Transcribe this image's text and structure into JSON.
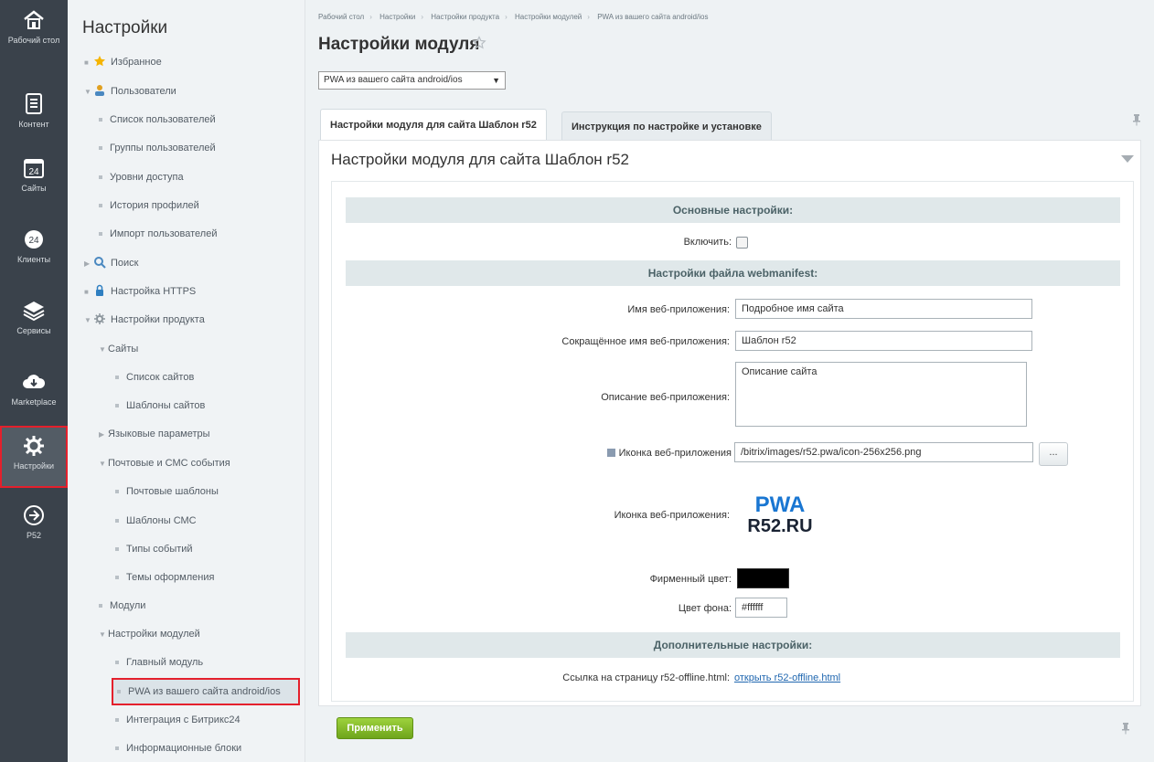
{
  "rail": [
    {
      "label": "Рабочий стол",
      "icon": "home-icon"
    },
    {
      "label": "Контент",
      "icon": "document-icon"
    },
    {
      "label": "Сайты",
      "icon": "calendar-icon",
      "badge": "24"
    },
    {
      "label": "Клиенты",
      "icon": "bitrix24-icon",
      "badge": "24"
    },
    {
      "label": "Сервисы",
      "icon": "layers-icon"
    },
    {
      "label": "Marketplace",
      "icon": "cloud-download-icon"
    },
    {
      "label": "Настройки",
      "icon": "gear-icon"
    },
    {
      "label": "Р52",
      "icon": "arrow-circle-icon"
    }
  ],
  "menu": {
    "title": "Настройки",
    "items": [
      {
        "label": "Избранное"
      },
      {
        "label": "Пользователи"
      },
      {
        "label": "Список пользователей"
      },
      {
        "label": "Группы пользователей"
      },
      {
        "label": "Уровни доступа"
      },
      {
        "label": "История профилей"
      },
      {
        "label": "Импорт пользователей"
      },
      {
        "label": "Поиск"
      },
      {
        "label": "Настройка HTTPS"
      },
      {
        "label": "Настройки продукта"
      },
      {
        "label": "Сайты"
      },
      {
        "label": "Список сайтов"
      },
      {
        "label": "Шаблоны сайтов"
      },
      {
        "label": "Языковые параметры"
      },
      {
        "label": "Почтовые и СМС события"
      },
      {
        "label": "Почтовые шаблоны"
      },
      {
        "label": "Шаблоны СМС"
      },
      {
        "label": "Типы событий"
      },
      {
        "label": "Темы оформления"
      },
      {
        "label": "Модули"
      },
      {
        "label": "Настройки модулей"
      },
      {
        "label": "Главный модуль"
      },
      {
        "label": "PWA из вашего сайта android/ios"
      },
      {
        "label": "Интеграция с Битрикс24"
      },
      {
        "label": "Информационные блоки"
      }
    ]
  },
  "breadcrumb": [
    "Рабочий стол",
    "Настройки",
    "Настройки продукта",
    "Настройки модулей",
    "PWA из вашего сайта android/ios"
  ],
  "page_title": "Настройки модуля",
  "module_select": "PWA из вашего сайта android/ios",
  "tabs": [
    {
      "label": "Настройки модуля для сайта Шаблон r52"
    },
    {
      "label": "Инструкция по настройке и установке"
    }
  ],
  "panel_title": "Настройки модуля для сайта Шаблон r52",
  "form": {
    "section_main": "Основные настройки:",
    "enable_label": "Включить:",
    "section_manifest": "Настройки файла webmanifest:",
    "app_name_label": "Имя веб-приложения:",
    "app_name_value": "Подробное имя сайта",
    "short_name_label": "Сокращённое имя веб-приложения:",
    "short_name_value": "Шаблон r52",
    "description_label": "Описание веб-приложения:",
    "description_value": "Описание сайта",
    "icon_path_label": "Иконка веб-приложения",
    "icon_path_value": "/bitrix/images/r52.pwa/icon-256x256.png",
    "browse_label": "...",
    "icon_preview_label": "Иконка веб-приложения:",
    "logo_line1": "PWA",
    "logo_line2": "R52.RU",
    "brand_color_label": "Фирменный цвет:",
    "brand_color": "#000000",
    "bg_color_label": "Цвет фона:",
    "bg_color_value": "#ffffff",
    "section_extra": "Дополнительные настройки:",
    "offline_label": "Ссылка на страницу r52-offline.html:",
    "offline_link": "открыть r52-offline.html"
  },
  "apply_label": "Применить"
}
